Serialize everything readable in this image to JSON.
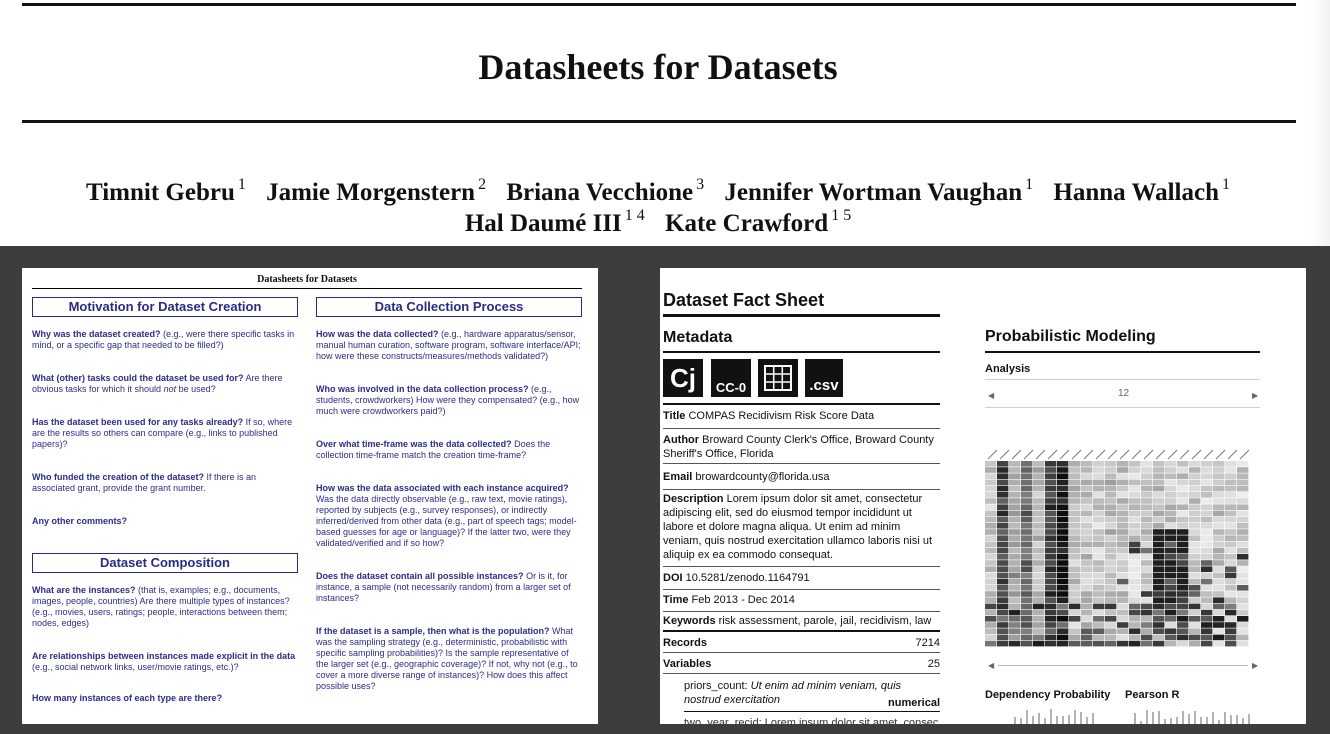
{
  "paper": {
    "title": "Datasheets for Datasets",
    "authors_line1": [
      {
        "name": "Timnit Gebru",
        "aff": "1"
      },
      {
        "name": "Jamie Morgenstern",
        "aff": "2"
      },
      {
        "name": "Briana Vecchione",
        "aff": "3"
      },
      {
        "name": "Jennifer Wortman Vaughan",
        "aff": "1"
      },
      {
        "name": "Hanna Wallach",
        "aff": "1"
      }
    ],
    "authors_line2": [
      {
        "name": "Hal Daumé III",
        "aff": "1 4"
      },
      {
        "name": "Kate Crawford",
        "aff": "1 5"
      }
    ]
  },
  "left_panel": {
    "header": "Datasheets for Datasets",
    "sec_motivation": "Motivation for Dataset Creation",
    "q_created_b": "Why was the dataset created?",
    "q_created_t": " (e.g., were there specific tasks in mind, or a specific gap that needed to be filled?)",
    "q_tasks_b": "What (other) tasks could the dataset be used for?",
    "q_tasks_t": " Are there obvious tasks for which it should ",
    "q_tasks_not": "not",
    "q_tasks_end": " be used?",
    "q_used_b": "Has the dataset been used for any tasks already?",
    "q_used_t": " If so, where are the results so others can compare (e.g., links to published papers)?",
    "q_funded_b": "Who funded the creation of the dataset?",
    "q_funded_t": " If there is an associated grant, provide the grant number.",
    "q_comments_b": "Any other comments?",
    "sec_composition": "Dataset Composition",
    "q_instances_b": "What are the instances?",
    "q_instances_t": " (that is, examples; e.g., documents, images, people, countries) Are there multiple types of instances? (e.g., movies, users, ratings; people, interactions between them; nodes, edges)",
    "q_relationships_b": "Are relationships between instances made explicit in the data",
    "q_relationships_t": " (e.g., social network links, user/movie ratings, etc.)?",
    "q_howmany_b": "How many instances of each type are there?",
    "sec_collection": "Data Collection Process",
    "q_collected_b": "How was the data collected?",
    "q_collected_t": " (e.g., hardware apparatus/sensor, manual human curation, software program, software interface/API; how were these constructs/measures/methods validated?)",
    "q_involved_b": "Who was involved in the data collection process?",
    "q_involved_t": " (e.g., students, crowdworkers) How were they compensated? (e.g., how much were crowdworkers paid?)",
    "q_timeframe_b": "Over what time-frame was the data collected?",
    "q_timeframe_t": " Does the collection time-frame match the creation time-frame?",
    "q_associated_b": "How was the data associated with each instance acquired?",
    "q_associated_t": " Was the data directly observable (e.g., raw text, movie ratings), reported by subjects (e.g., survey responses), or indirectly inferred/derived from other data (e.g., part of speech tags; model-based guesses for age or language)? If the latter two, were they validated/verified and if so how?",
    "q_possible_b": "Does the dataset contain all possible instances?",
    "q_possible_t": " Or is it, for instance, a sample (not necessarily random) from a larger set of instances?",
    "q_sample_b": "If the dataset is a sample, then what is the population?",
    "q_sample_t": " What was the sampling strategy (e.g., deterministic, probabilistic with specific sampling probabilities)? Is the sample representative of the larger set (e.g., geographic coverage)? If not, why not (e.g., to cover a more diverse range of instances)? How does this affect possible uses?"
  },
  "right_panel": {
    "title": "Dataset Fact Sheet",
    "metadata": "Metadata",
    "badge_cj": "Cj",
    "badge_cc": "CC-0",
    "badge_csv": ".csv",
    "title_label": "Title",
    "title_value": " COMPAS Recidivism Risk Score Data",
    "author_label": "Author",
    "author_value": " Broward County Clerk's Office, Broward County Sheriff's Office, Florida",
    "email_label": "Email",
    "email_value": " browardcounty@florida.usa",
    "description_label": "Description",
    "description_value": " Lorem ipsum dolor sit amet, consectetur adipiscing elit, sed do eiusmod tempor incididunt ut labore et dolore magna aliqua. Ut enim ad minim veniam, quis nostrud exercitation ullamco laboris nisi ut aliquip ex ea commodo consequat.",
    "doi_label": "DOI",
    "doi_value": " 10.5281/zenodo.1164791",
    "time_label": "Time",
    "time_value": " Feb 2013 - Dec 2014",
    "keywords_label": "Keywords",
    "keywords_value": " risk assessment, parole, jail, recidivism, law",
    "records_label": "Records",
    "records_value": "7214",
    "variables_label": "Variables",
    "variables_value": "25",
    "var_name": "priors_count:",
    "var_desc": " Ut enim ad minim veniam, quis nostrud exercitation",
    "var_type": "numerical",
    "var_next": "two_year_recid: Lorem ipsum dolor sit amet, consec",
    "pm_title": "Probabilistic Modeling",
    "pm_analysis": "Analysis",
    "pm_slider_value": "12",
    "dep_prob": "Dependency Probability",
    "pearson": "Pearson R"
  },
  "colors": {
    "figure_band": "#3d3d3d",
    "question_blue": "#2c2c8a",
    "section_blue": "#2a2a88"
  }
}
